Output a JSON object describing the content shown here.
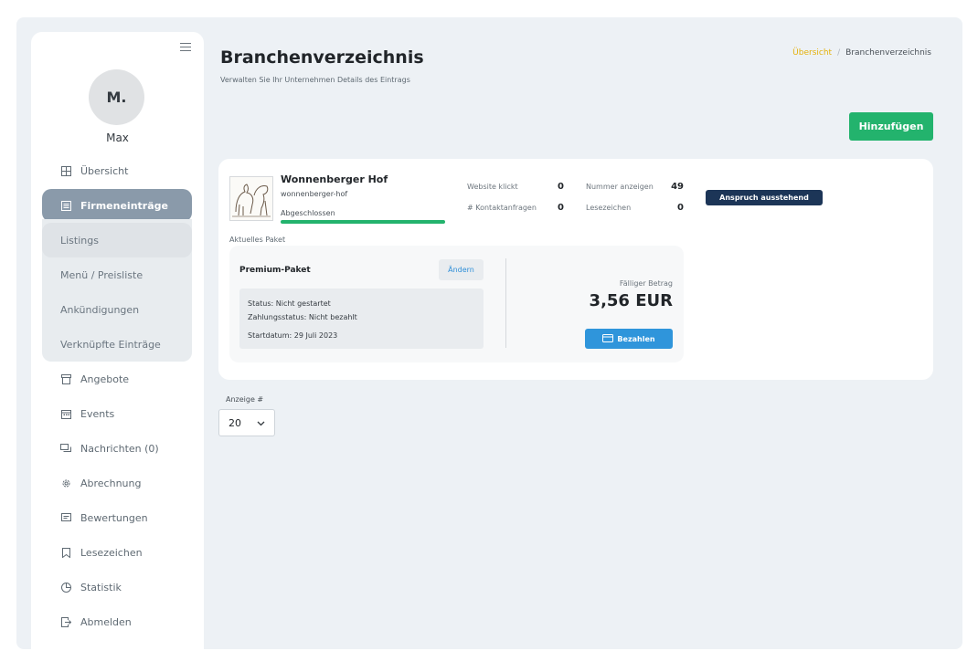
{
  "user": {
    "initials": "M.",
    "name": "Max"
  },
  "nav": {
    "overview": "Übersicht",
    "listings_parent": "Firmeneinträge",
    "sub": [
      "Listings",
      "Menü / Preisliste",
      "Ankündigungen",
      "Verknüpfte Einträge"
    ],
    "items": [
      {
        "label": "Angebote",
        "icon": "archive-icon"
      },
      {
        "label": "Events",
        "icon": "calendar-icon"
      },
      {
        "label": "Nachrichten (0)",
        "icon": "chat-icon"
      },
      {
        "label": "Abrechnung",
        "icon": "gear-icon"
      },
      {
        "label": "Bewertungen",
        "icon": "review-icon"
      },
      {
        "label": "Lesezeichen",
        "icon": "bookmark-icon"
      },
      {
        "label": "Statistik",
        "icon": "pie-chart-icon"
      },
      {
        "label": "Abmelden",
        "icon": "logout-icon"
      }
    ]
  },
  "header": {
    "title": "Branchenverzeichnis",
    "subtitle": "Verwalten Sie Ihr Unternehmen Details des Eintrags",
    "breadcrumb": {
      "home": "Übersicht",
      "current": "Branchenverzeichnis"
    },
    "add_label": "Hinzufügen"
  },
  "listing": {
    "name": "Wonnenberger Hof",
    "slug": "wonnenberger-hof",
    "status": "Abgeschlossen",
    "progress": 1.0,
    "stats": {
      "website_clicks_label": "Website klickt",
      "website_clicks": "0",
      "contacts_label": "# Kontaktanfragen",
      "contacts": "0",
      "phone_label": "Nummer anzeigen",
      "phone": "49",
      "bookmarks_label": "Lesezeichen",
      "bookmarks": "0"
    },
    "badge": "Anspruch ausstehend",
    "package_caption": "Aktuelles Paket",
    "package": {
      "name": "Premium-Paket",
      "change_label": "Ändern",
      "status": "Status: Nicht gestartet",
      "payment_status": "Zahlungsstatus: Nicht bezahlt",
      "start_date": "Startdatum: 29 Juli 2023",
      "due_label": "Fälliger Betrag",
      "due_amount": "3,56 EUR",
      "pay_label": "Bezahlen"
    }
  },
  "pagination": {
    "label": "Anzeige #",
    "value": "20"
  },
  "colors": {
    "accent_green": "#23b36d",
    "accent_blue": "#2f95db",
    "badge_navy": "#1c3557",
    "breadcrumb_link": "#e4b10a"
  }
}
